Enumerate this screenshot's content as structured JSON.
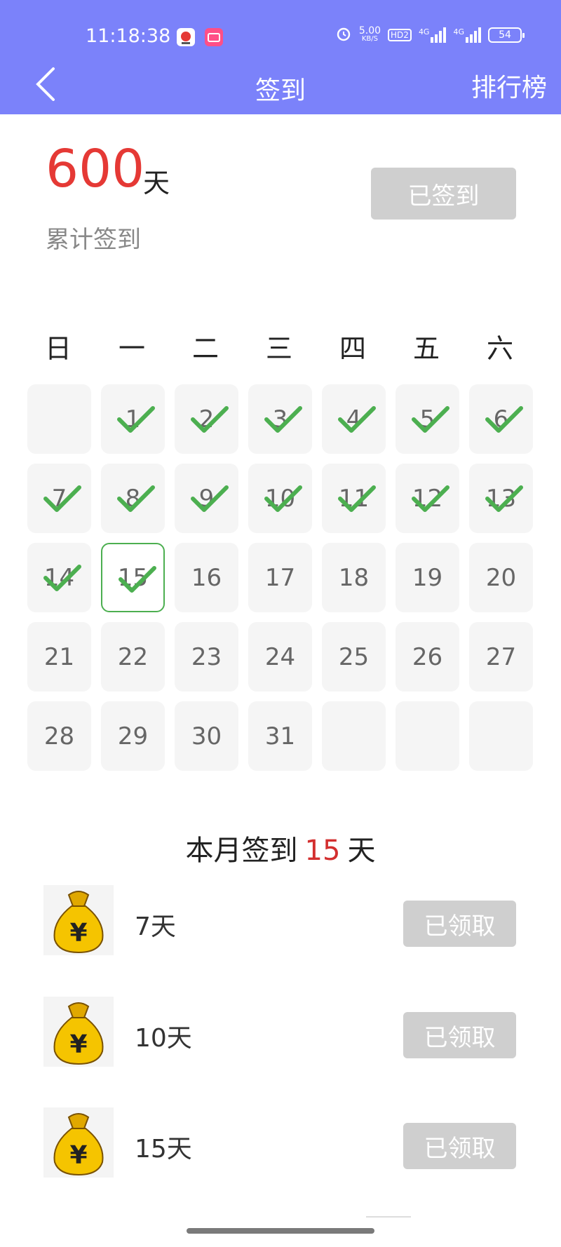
{
  "status_bar": {
    "time": "11:18:38",
    "net_speed_value": "5.00",
    "net_speed_unit": "KB/S",
    "hd_badge": "HD2",
    "network_1": "4G",
    "network_2": "4G",
    "battery": "54"
  },
  "nav": {
    "title": "签到",
    "right_label": "排行榜"
  },
  "summary": {
    "total_days": "600",
    "unit": "天",
    "label": "累计签到",
    "button_label": "已签到"
  },
  "calendar": {
    "weekdays": [
      "日",
      "一",
      "二",
      "三",
      "四",
      "五",
      "六"
    ],
    "days": [
      {
        "label": "",
        "checked": false,
        "today": false
      },
      {
        "label": "1",
        "checked": true,
        "today": false
      },
      {
        "label": "2",
        "checked": true,
        "today": false
      },
      {
        "label": "3",
        "checked": true,
        "today": false
      },
      {
        "label": "4",
        "checked": true,
        "today": false
      },
      {
        "label": "5",
        "checked": true,
        "today": false
      },
      {
        "label": "6",
        "checked": true,
        "today": false
      },
      {
        "label": "7",
        "checked": true,
        "today": false
      },
      {
        "label": "8",
        "checked": true,
        "today": false
      },
      {
        "label": "9",
        "checked": true,
        "today": false
      },
      {
        "label": "10",
        "checked": true,
        "today": false
      },
      {
        "label": "11",
        "checked": true,
        "today": false
      },
      {
        "label": "12",
        "checked": true,
        "today": false
      },
      {
        "label": "13",
        "checked": true,
        "today": false
      },
      {
        "label": "14",
        "checked": true,
        "today": false
      },
      {
        "label": "15",
        "checked": true,
        "today": true
      },
      {
        "label": "16",
        "checked": false,
        "today": false
      },
      {
        "label": "17",
        "checked": false,
        "today": false
      },
      {
        "label": "18",
        "checked": false,
        "today": false
      },
      {
        "label": "19",
        "checked": false,
        "today": false
      },
      {
        "label": "20",
        "checked": false,
        "today": false
      },
      {
        "label": "21",
        "checked": false,
        "today": false
      },
      {
        "label": "22",
        "checked": false,
        "today": false
      },
      {
        "label": "23",
        "checked": false,
        "today": false
      },
      {
        "label": "24",
        "checked": false,
        "today": false
      },
      {
        "label": "25",
        "checked": false,
        "today": false
      },
      {
        "label": "26",
        "checked": false,
        "today": false
      },
      {
        "label": "27",
        "checked": false,
        "today": false
      },
      {
        "label": "28",
        "checked": false,
        "today": false
      },
      {
        "label": "29",
        "checked": false,
        "today": false
      },
      {
        "label": "30",
        "checked": false,
        "today": false
      },
      {
        "label": "31",
        "checked": false,
        "today": false
      },
      {
        "label": "",
        "checked": false,
        "today": false
      },
      {
        "label": "",
        "checked": false,
        "today": false
      },
      {
        "label": "",
        "checked": false,
        "today": false
      }
    ]
  },
  "month": {
    "prefix": "本月签到",
    "count": "15",
    "suffix": "天"
  },
  "rewards": [
    {
      "label": "7天",
      "button": "已领取",
      "icon": "money-bag-icon"
    },
    {
      "label": "10天",
      "button": "已领取",
      "icon": "money-bag-icon"
    },
    {
      "label": "15天",
      "button": "已领取",
      "icon": "money-bag-icon"
    }
  ],
  "colors": {
    "header_bg": "#7b82fa",
    "accent_red": "#e53935",
    "check_green": "#4caf50",
    "disabled_button": "#cfcfcf"
  }
}
